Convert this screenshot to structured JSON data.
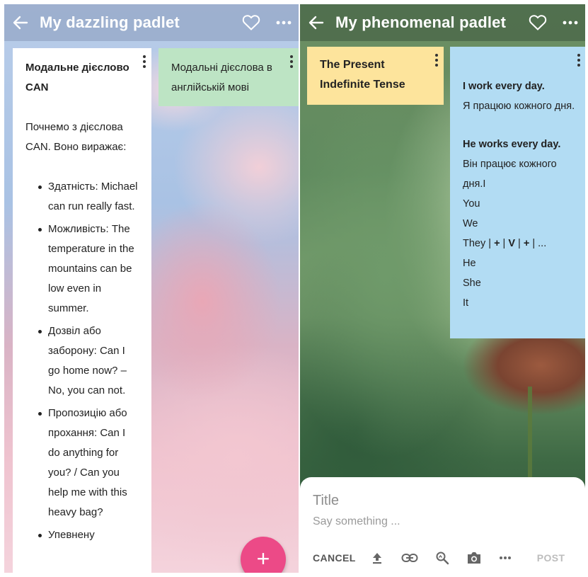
{
  "left": {
    "header": {
      "title": "My dazzling padlet"
    },
    "cards": {
      "can": {
        "title": "Модальне дієслово CAN",
        "intro": "Почнемо з дієслова CAN. Воно виражає:",
        "bullets": [
          "Здатність: Michael can run really fast.",
          "Можливість: The temperature in the mountains can be low even in summer.",
          "Дозвіл або заборону: Can I go home now? – No, you can not.",
          "Пропозицію або прохання: Can I do anything for you? / Can you help me with this heavy bag?",
          "Упевнену"
        ]
      },
      "modal": {
        "text": "Модальні дієслова в англійській мові"
      }
    },
    "fab": {
      "label": "+",
      "color": "#ec4a87"
    }
  },
  "right": {
    "header": {
      "title": "My phenomenal padlet"
    },
    "cards": {
      "present": {
        "text": "The Present Indefinite Tense"
      },
      "works": {
        "line1_en": "I work every day.",
        "line1_ua": "Я працюю кожного дня.",
        "line2_en": "He works every day.",
        "line2_ua": "Він працює кожного дня.І",
        "pronouns": [
          "You",
          "We",
          "They | + | V | + | ...",
          "He",
          "She",
          "It"
        ]
      }
    },
    "compose": {
      "title_placeholder": "Title",
      "body_placeholder": "Say something ...",
      "cancel_label": "CANCEL",
      "post_label": "POST",
      "tools": [
        "upload-icon",
        "link-icon",
        "search-image-icon",
        "camera-icon",
        "more-icon"
      ]
    }
  },
  "colors": {
    "card_white": "#ffffff",
    "card_green": "#bde4c4",
    "card_yellow": "#fde49c",
    "card_blue": "#b2dcf3",
    "fab_pink": "#ec4a87"
  }
}
